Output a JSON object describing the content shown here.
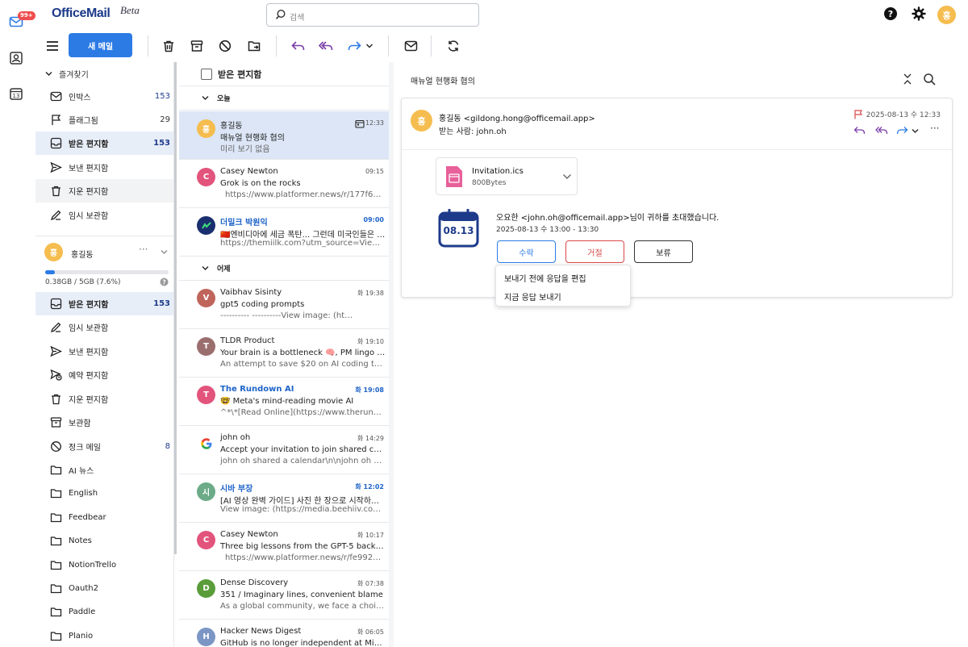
{
  "app": {
    "logo": "OfficeMail",
    "logo_beta": "Beta",
    "unread_badge": "99+",
    "rail_calendar_day": "13",
    "user_initial": "홍",
    "search_placeholder": "검색"
  },
  "toolbar": {
    "new_mail": "새 메일"
  },
  "sidebar": {
    "favorites_header": "즐겨찾기",
    "favorites": [
      {
        "label": "인박스",
        "count": "153"
      },
      {
        "label": "플래그됨",
        "count": "29"
      },
      {
        "label": "받은 편지함",
        "count": "153"
      },
      {
        "label": "보낸 편지함",
        "count": ""
      },
      {
        "label": "지운 편지함",
        "count": ""
      },
      {
        "label": "임시 보관함",
        "count": ""
      }
    ],
    "account_name": "홍길동",
    "quota": "0.38GB / 5GB (7.6%)",
    "quota_fraction": 0.076,
    "folders": [
      {
        "label": "받은 편지함",
        "count": "153"
      },
      {
        "label": "임시 보관함",
        "count": ""
      },
      {
        "label": "보낸 편지함",
        "count": ""
      },
      {
        "label": "예약 편지함",
        "count": ""
      },
      {
        "label": "지운 편지함",
        "count": ""
      },
      {
        "label": "보관함",
        "count": ""
      },
      {
        "label": "정크 메일",
        "count": "8"
      },
      {
        "label": "AI 뉴스",
        "count": ""
      },
      {
        "label": "English",
        "count": ""
      },
      {
        "label": "Feedbear",
        "count": ""
      },
      {
        "label": "Notes",
        "count": ""
      },
      {
        "label": "NotionTrello",
        "count": ""
      },
      {
        "label": "Oauth2",
        "count": ""
      },
      {
        "label": "Paddle",
        "count": ""
      },
      {
        "label": "Planio",
        "count": ""
      }
    ]
  },
  "list": {
    "header": "받은 편지함",
    "group_today": "오늘",
    "group_yesterday": "어제",
    "mails": [
      {
        "initial": "홍",
        "color": "#f5bd4f",
        "from": "홍길동",
        "time": "12:33",
        "subject": "매뉴얼 현행화 협의",
        "preview": "미리 보기 없음",
        "unread": false
      },
      {
        "initial": "C",
        "color": "#e2547c",
        "from": "Casey Newton",
        "time": "09:15",
        "subject": "Grok is on the rocks",
        "preview": "https://www.platformer.news/r/177f656…",
        "unread": false
      },
      {
        "initial": "",
        "color": "#1a2f6e",
        "from": "더밀크 박원익",
        "time": "09:00",
        "subject": "🇨🇳엔비디아에 세금 폭탄... 그런데 미국인들은 왜…",
        "preview": "https://themiilk.com?utm_source=Viewsle…",
        "unread": true
      },
      {
        "initial": "V",
        "color": "#c0655c",
        "from": "Vaibhav Sisinty",
        "time": "화 19:38",
        "subject": "gpt5 coding prompts",
        "preview": "‑‑‑‑‑‑‑‑‑‑ ‑‑‑‑‑‑‑‑‑‑View image: (ht…",
        "unread": false
      },
      {
        "initial": "T",
        "color": "#9b6e6e",
        "from": "TLDR Product",
        "time": "화 19:10",
        "subject": "Your brain is a bottleneck 🧠, PM lingo 💬,…",
        "preview": "An attempt to save $20 on AI coding tool…",
        "unread": false
      },
      {
        "initial": "T",
        "color": "#e2547c",
        "from": "The Rundown AI",
        "time": "화 19:08",
        "subject": "🤓 Meta's mind-reading movie AI",
        "preview": "^*\\*[Read Online](https://www.therundown…",
        "unread": true
      },
      {
        "initial": "G",
        "color": "#ffffff",
        "from": "john oh",
        "time": "화 14:29",
        "subject": "Accept your invitation to join shared calen…",
        "preview": "john oh shared a calendar\\n\\njohn oh <jo…",
        "unread": false
      },
      {
        "initial": "시",
        "color": "#6bab87",
        "from": "시바 부장",
        "time": "화 12:02",
        "subject": "[AI 영상 완벽 가이드] 사진 한 장으로 시작하는 …",
        "preview": "View image: (https://media.beehiiv.com/c…",
        "unread": true
      },
      {
        "initial": "C",
        "color": "#e2547c",
        "from": "Casey Newton",
        "time": "화 10:17",
        "subject": "Three big lessons from the GPT-5 backlash",
        "preview": "https://www.platformer.news/r/fe9927b…",
        "unread": false
      },
      {
        "initial": "D",
        "color": "#5a9c3a",
        "from": "Dense Discovery",
        "time": "화 07:38",
        "subject": "351 / Imaginary lines, convenient blame",
        "preview": "As a global community, we face a choice.…",
        "unread": false
      },
      {
        "initial": "H",
        "color": "#7b96c4",
        "from": "Hacker News Digest",
        "time": "화 06:05",
        "subject": "GitHub is no longer independent at Micro…",
        "preview": "",
        "unread": false
      }
    ]
  },
  "reader": {
    "title": "매뉴얼 현행화 협의",
    "sender_initial": "홍",
    "sender": "홍길동 <gildong.hong@officemail.app>",
    "to": "받는 사람: john.oh",
    "date": "2025-08-13 수 12:33",
    "attachment_name": "Invitation.ics",
    "attachment_size": "800Bytes",
    "calendar_date": "08.13",
    "invite_text": "오요한 <john.oh@officemail.app>님이 귀하를 초대했습니다.",
    "invite_time": "2025-08-13 수 13:00 - 13:30",
    "accept": "수락",
    "decline": "거절",
    "tentative": "보류",
    "menu_edit": "보내기 전에 응답을 편집",
    "menu_send": "지금 응답 보내기"
  },
  "colors": {
    "accent": "#2c7be5",
    "brand": "#1d3a8a",
    "decline": "#d94848",
    "reply": "#7a3fa8"
  }
}
